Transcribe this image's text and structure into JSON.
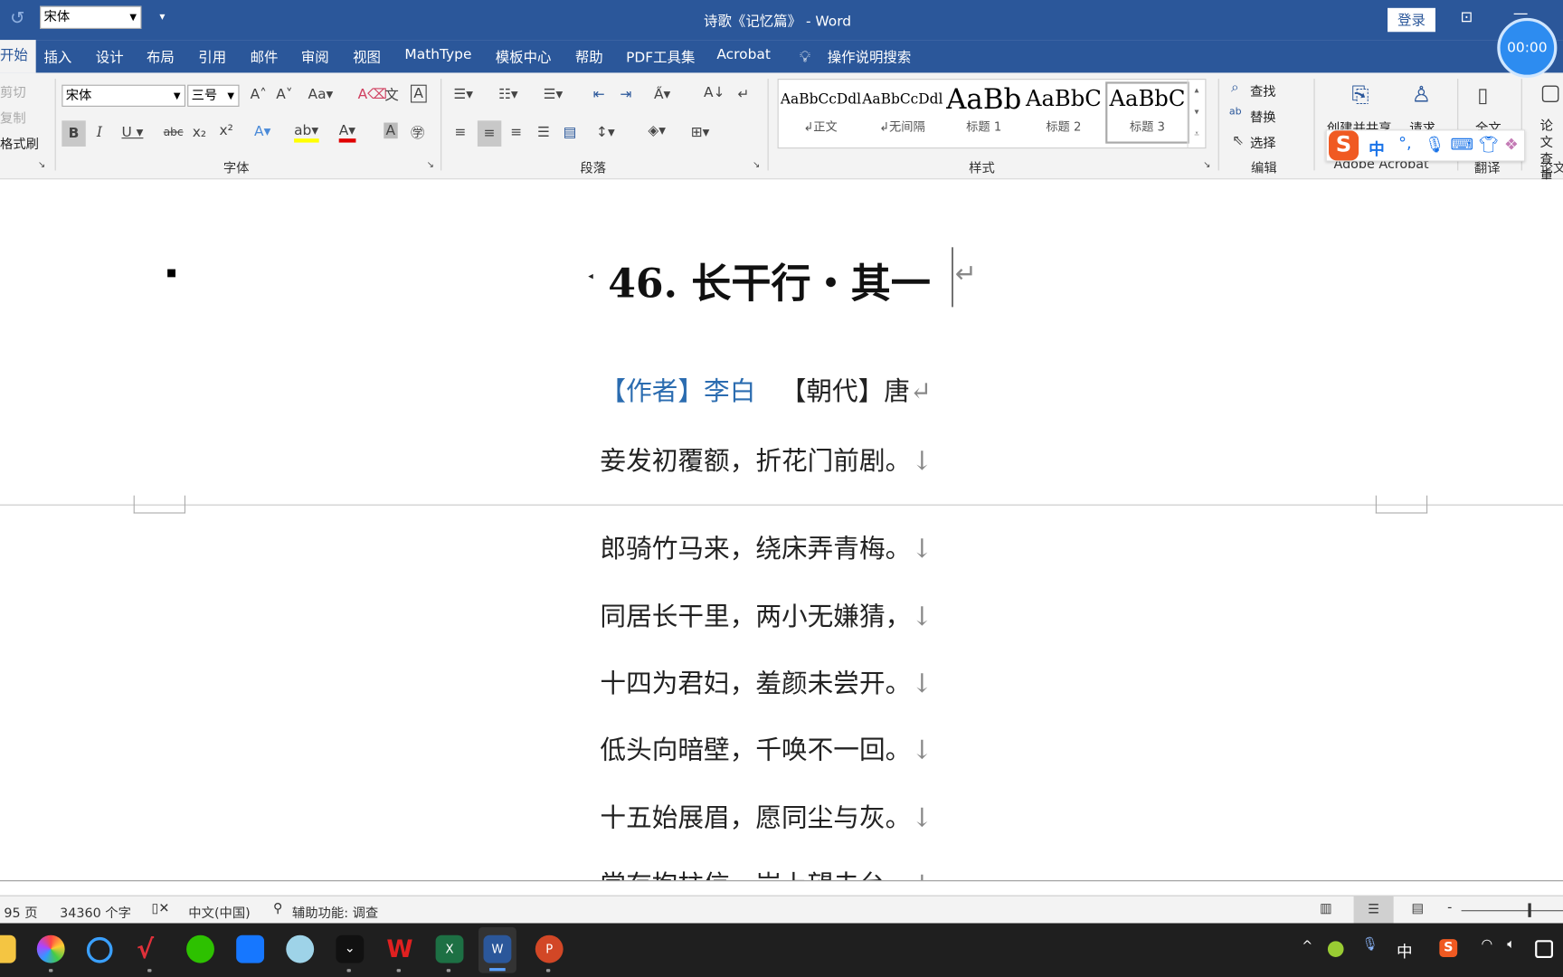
{
  "window": {
    "title": "诗歌《记忆篇》 - Word",
    "login": "登录",
    "timer": "00:00"
  },
  "qat": {
    "font_value": "宋体"
  },
  "tabs": [
    "开始",
    "插入",
    "设计",
    "布局",
    "引用",
    "邮件",
    "审阅",
    "视图",
    "MathType",
    "模板中心",
    "帮助",
    "PDF工具集",
    "Acrobat"
  ],
  "tell_me": "操作说明搜索",
  "clipboard": {
    "cut": "剪切",
    "copy": "复制",
    "format_painter": "格式刷"
  },
  "font_group": {
    "label": "字体",
    "font": "宋体",
    "size": "三号"
  },
  "paragraph_group": {
    "label": "段落"
  },
  "styles_group": {
    "label": "样式",
    "items": [
      {
        "preview": "AaBbCcDdl",
        "name": "↲正文"
      },
      {
        "preview": "AaBbCcDdl",
        "name": "↲无间隔"
      },
      {
        "preview": "AaBb",
        "name": "标题 1"
      },
      {
        "preview": "AaBbC",
        "name": "标题 2"
      },
      {
        "preview": "AaBbC",
        "name": "标题 3"
      }
    ]
  },
  "editing_group": {
    "label": "编辑",
    "find": "查找",
    "replace": "替换",
    "select": "选择"
  },
  "acrobat_group": {
    "label": "Adobe Acrobat",
    "create_share": "创建并共享",
    "request": "请求"
  },
  "translate_group": {
    "label": "翻译",
    "full": "全文"
  },
  "paper_group": {
    "label": "论文",
    "check": "论文查重"
  },
  "ime": {
    "mode": "中"
  },
  "document": {
    "title": "46. 长干行・其一",
    "author_label": "【作者】李白",
    "dynasty_label": "【朝代】唐",
    "lines": [
      "妾发初覆额，折花门前剧。",
      "郎骑竹马来，绕床弄青梅。",
      "同居长干里，两小无嫌猜，",
      "十四为君妇，羞颜未尝开。",
      "低头向暗壁，千唤不一回。",
      "十五始展眉，愿同尘与灰。",
      "常存抱柱信，岂上望夫台。"
    ]
  },
  "status": {
    "page": "95 页",
    "words": "34360 个字",
    "language": "中文(中国)",
    "accessibility": "辅助功能: 调查"
  },
  "tray": {
    "ime": "中"
  }
}
